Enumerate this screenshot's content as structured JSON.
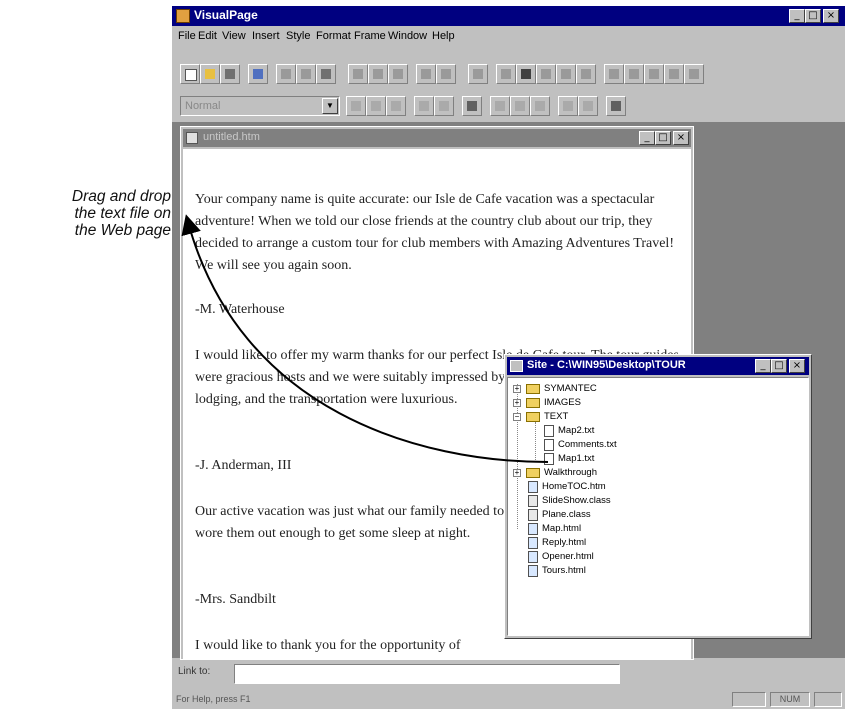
{
  "annotation": {
    "lines": [
      "Drag and drop",
      "the text file on",
      "the Web page"
    ]
  },
  "app": {
    "title": "VisualPage",
    "menu": [
      "File",
      "Edit",
      "View",
      "Insert",
      "Style",
      "Format",
      "Frame",
      "Window",
      "Help"
    ],
    "style_value": "Normal",
    "link_label": "Link to:",
    "link_value": "",
    "status_text": "For Help, press F1",
    "num_indicator": "NUM"
  },
  "document": {
    "title": "untitled.htm",
    "paragraphs": [
      "Your company name is quite accurate: our Isle de Cafe vacation was a spectacular adventure! When we told our close friends at the country club about our trip, they decided to arrange a custom tour for club members with Amazing Adventures Travel! We will see you again soon.",
      "-M. Waterhouse",
      "I would like to offer my warm thanks for our perfect Isle de Cafe tour. The tour guides were gracious hosts and we were suitably impressed by their service. The food, the lodging, and the transportation were luxurious.",
      "-J. Anderman, III",
      "Our active vacation was just what our family needed to impress our teenagers, and wore them out enough to get some sleep at night.",
      "-Mrs. Sandbilt",
      "I would like to thank you for the opportunity of"
    ]
  },
  "site": {
    "title": "Site - C:\\WIN95\\Desktop\\TOUR",
    "items": [
      {
        "label": "SYMANTEC",
        "type": "folder"
      },
      {
        "label": "IMAGES",
        "type": "folder"
      },
      {
        "label": "TEXT",
        "type": "folder-open"
      },
      {
        "label": "Map2.txt",
        "type": "file"
      },
      {
        "label": "Comments.txt",
        "type": "file"
      },
      {
        "label": "Map1.txt",
        "type": "file"
      },
      {
        "label": "Walkthrough",
        "type": "folder"
      },
      {
        "label": "HomeTOC.htm",
        "type": "file"
      },
      {
        "label": "SlideShow.class",
        "type": "file"
      },
      {
        "label": "Plane.class",
        "type": "file"
      },
      {
        "label": "Map.html",
        "type": "file"
      },
      {
        "label": "Reply.html",
        "type": "file"
      },
      {
        "label": "Opener.html",
        "type": "file"
      },
      {
        "label": "Tours.html",
        "type": "file"
      }
    ]
  }
}
